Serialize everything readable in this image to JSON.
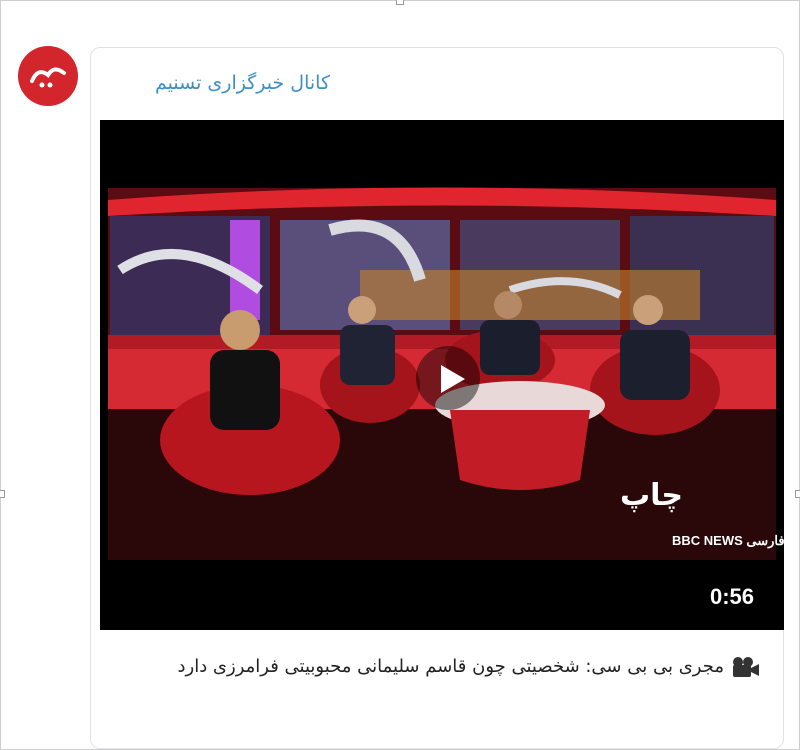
{
  "channel": {
    "name": "کانال خبرگزاری تسنیم",
    "avatar_icon": "tasnim-logo-icon"
  },
  "video": {
    "duration": "0:56",
    "watermark": "BBC NEWS فارسی",
    "program_logo": "چاپ",
    "play_icon": "play-icon"
  },
  "post": {
    "icon": "video-camera-icon",
    "text": "مجری بی بی سی: شخصیتی چون قاسم سلیمانی محبوبیتی فرامرزی دارد"
  },
  "colors": {
    "accent": "#3d8fc6",
    "avatar_bg": "#d3252c",
    "studio_red": "#d0202b"
  }
}
